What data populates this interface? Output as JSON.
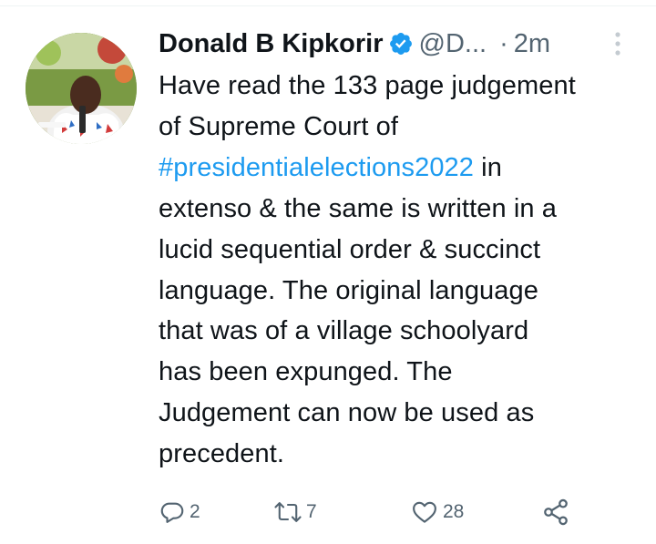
{
  "tweet": {
    "author": {
      "display_name": "Donald B Kipkorir",
      "handle": "@D...",
      "verified_icon": "verified-badge-icon"
    },
    "separator": "·",
    "time": "2m",
    "text_lines": [
      {
        "text": "Have read the 133 page judgement"
      },
      {
        "text": "of Supreme Court of"
      },
      {
        "hashtag": "#presidentialelections2022",
        "text": " in"
      },
      {
        "text": "extenso & the same is written in a"
      },
      {
        "text": "lucid sequential order & succinct"
      },
      {
        "text": "language. The original language"
      },
      {
        "text": "that was of a village schoolyard"
      },
      {
        "text": "has been expunged. The"
      },
      {
        "text": "Judgement can now be used as"
      },
      {
        "text": "precedent."
      }
    ],
    "actions": {
      "reply": {
        "icon": "reply-icon",
        "count": "2"
      },
      "retweet": {
        "icon": "retweet-icon",
        "count": "7"
      },
      "like": {
        "icon": "heart-icon",
        "count": "28"
      },
      "share": {
        "icon": "share-icon"
      }
    },
    "more_icon": "more-vertical-icon"
  },
  "colors": {
    "text": "#0f1419",
    "secondary": "#536471",
    "link": "#1d9bf0",
    "verified": "#1d9bf0"
  }
}
